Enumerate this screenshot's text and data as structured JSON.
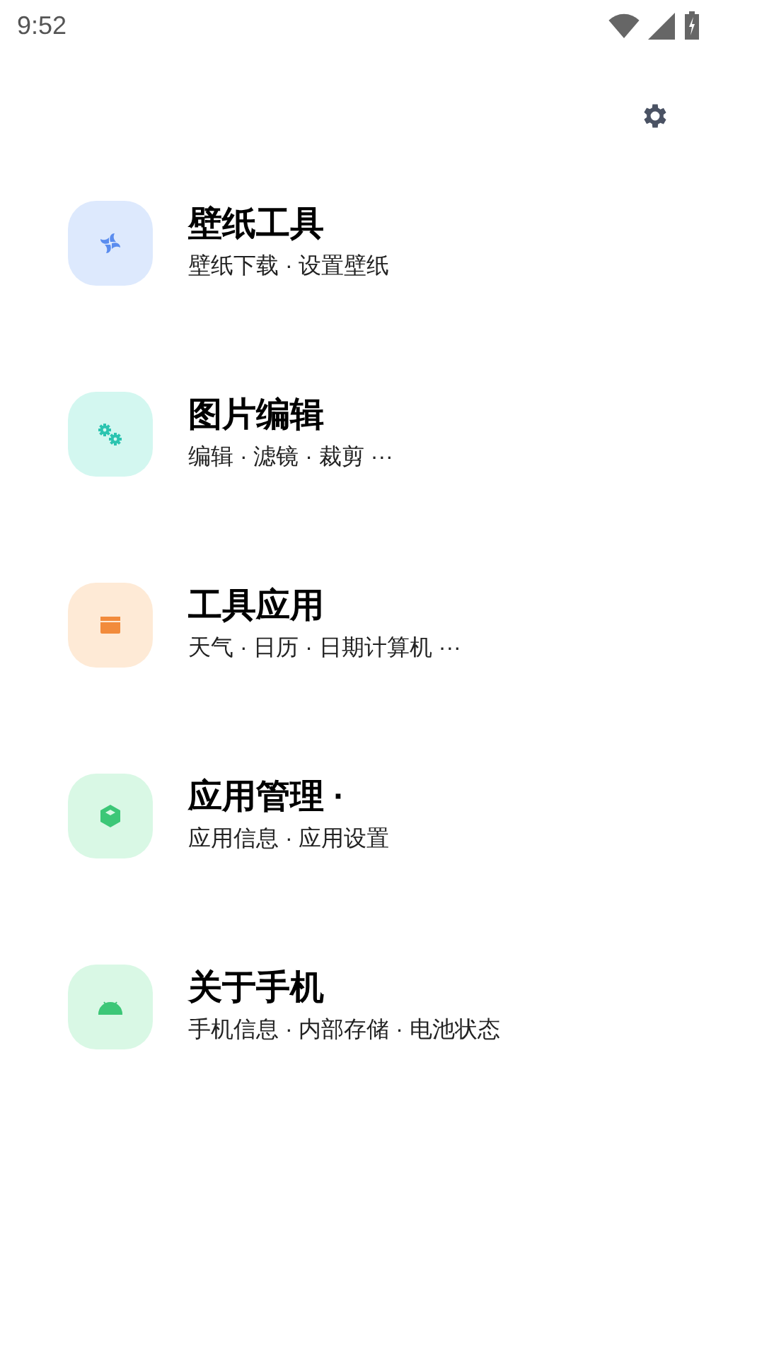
{
  "status_bar": {
    "time": "9:52"
  },
  "items": [
    {
      "kind": "fan",
      "color": "#5b8def",
      "title": "壁纸工具",
      "subtitle": "壁纸下载 · 设置壁纸"
    },
    {
      "kind": "gears",
      "color": "#2bc4b0",
      "title": "图片编辑",
      "subtitle": "编辑 · 滤镜 · 裁剪 ···"
    },
    {
      "kind": "box",
      "color": "#f28b3c",
      "title": "工具应用",
      "subtitle": "天气 · 日历 · 日期计算机 ···"
    },
    {
      "kind": "cube",
      "color": "#3cc777",
      "title": "应用管理 ·",
      "subtitle": "应用信息 · 应用设置"
    },
    {
      "kind": "android",
      "color": "#3cc777",
      "title": "关于手机",
      "subtitle": "手机信息 · 内部存储 · 电池状态"
    }
  ]
}
